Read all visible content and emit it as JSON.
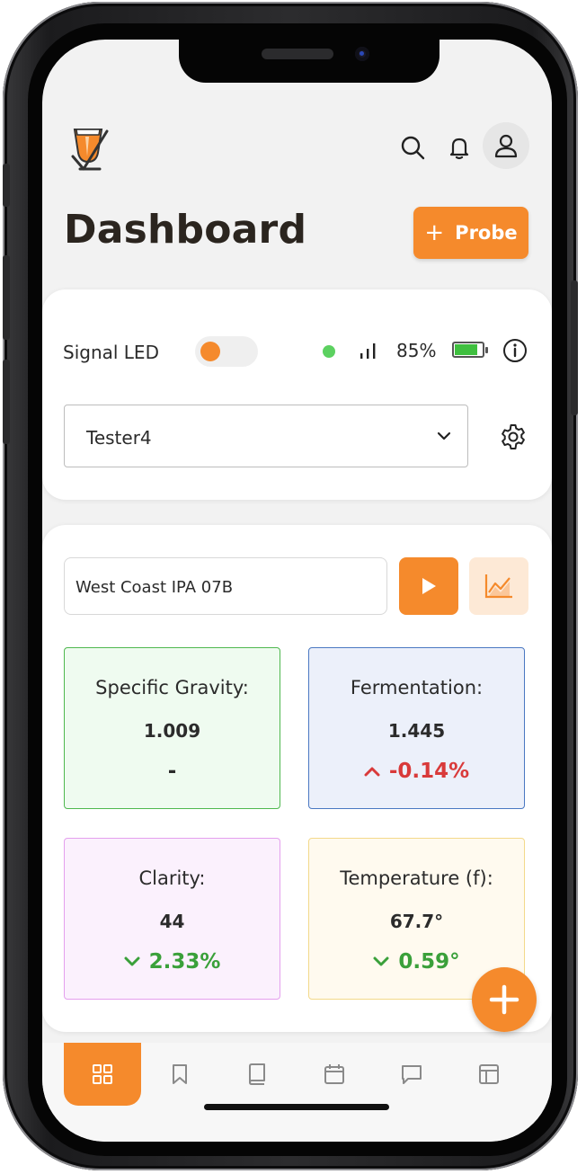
{
  "app": {
    "logo_icon": "beer-glass-check-icon"
  },
  "header": {
    "title": "Dashboard",
    "probe_button": {
      "plus": "+",
      "label": "Probe"
    },
    "icons": [
      "search-icon",
      "bell-icon",
      "user-icon"
    ]
  },
  "device": {
    "signal_led_label": "Signal LED",
    "signal_led_on": true,
    "connection_status_color": "#5cd160",
    "battery_pct": "85%",
    "battery_level": 0.85,
    "selected_device": "Tester4"
  },
  "batch": {
    "name": "West Coast IPA 07B"
  },
  "metrics": {
    "specific_gravity": {
      "label": "Specific Gravity:",
      "value": "1.009",
      "change": "-"
    },
    "fermentation": {
      "label": "Fermentation:",
      "value": "1.445",
      "change": "-0.14%",
      "direction": "up",
      "color": "#d93a3a"
    },
    "clarity": {
      "label": "Clarity:",
      "value": "44",
      "change": "2.33%",
      "direction": "down",
      "color": "#3aa03a"
    },
    "temperature": {
      "label": "Temperature (f):",
      "value": "67.7°",
      "change": "0.59°",
      "direction": "down",
      "color": "#3aa03a"
    }
  },
  "bottom_nav": [
    "grid-icon",
    "bookmark-icon",
    "book-icon",
    "calendar-icon",
    "chat-icon",
    "layout-icon"
  ],
  "colors": {
    "accent": "#f58a2c",
    "accent_light": "#fde9d6"
  }
}
